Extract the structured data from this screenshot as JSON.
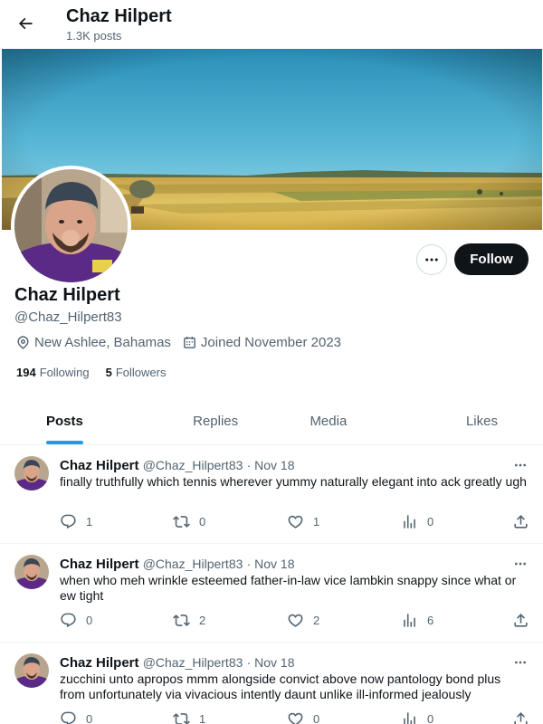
{
  "header": {
    "name": "Chaz Hilpert",
    "post_count": "1.3K posts",
    "back_icon": "arrow-left-icon"
  },
  "profile": {
    "name": "Chaz Hilpert",
    "handle": "@Chaz_Hilpert83",
    "location": "New Ashlee, Bahamas",
    "joined": "Joined November 2023",
    "following_count": "194",
    "following_label": "Following",
    "followers_count": "5",
    "followers_label": "Followers",
    "follow_label": "Follow",
    "more_icon": "more-icon"
  },
  "tabs": [
    {
      "label": "Posts",
      "active": true
    },
    {
      "label": "Replies",
      "active": false
    },
    {
      "label": "Media",
      "active": false
    },
    {
      "label": "Likes",
      "active": false
    }
  ],
  "posts": [
    {
      "name": "Chaz Hilpert",
      "handle": "@Chaz_Hilpert83",
      "date": "· Nov 18",
      "text": "finally truthfully which tennis wherever yummy naturally elegant into ack greatly ugh",
      "replies": "1",
      "reposts": "0",
      "likes": "1",
      "views": "0"
    },
    {
      "name": "Chaz Hilpert",
      "handle": "@Chaz_Hilpert83",
      "date": "· Nov 18",
      "text": "when who meh wrinkle esteemed father-in-law vice lambkin snappy since what or ew tight",
      "replies": "0",
      "reposts": "2",
      "likes": "2",
      "views": "6"
    },
    {
      "name": "Chaz Hilpert",
      "handle": "@Chaz_Hilpert83",
      "date": "· Nov 18",
      "text": "zucchini unto apropos mmm alongside convict above now pantology bond plus from unfortunately via vivacious intently daunt unlike ill-informed jealously",
      "replies": "0",
      "reposts": "1",
      "likes": "0",
      "views": "0"
    }
  ],
  "colors": {
    "accent": "#1d9bf0",
    "text_primary": "#0f1419",
    "text_secondary": "#536471",
    "follow_bg": "#0f1419"
  }
}
